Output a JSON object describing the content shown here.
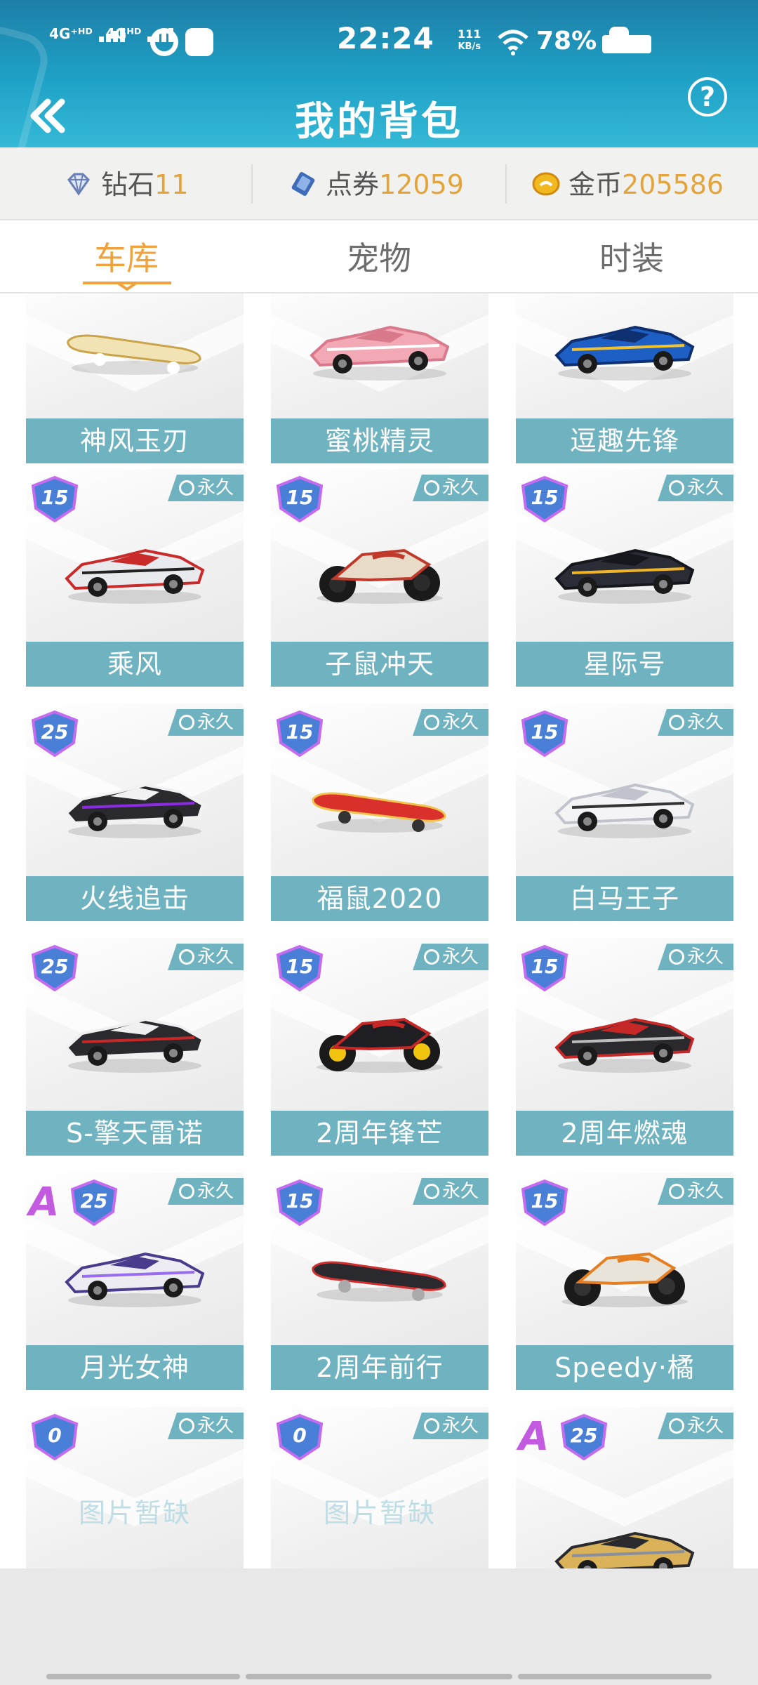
{
  "status_bar": {
    "signal1": "4G⁺ᴴᴰ",
    "signal2": "4Gᴴᴰ",
    "time": "22:24",
    "net_speed_value": "111",
    "net_speed_unit": "KB/s",
    "battery": "78%"
  },
  "header": {
    "title": "我的背包"
  },
  "currencies": [
    {
      "label": "钻石",
      "value": "11"
    },
    {
      "label": "点券",
      "value": "12059"
    },
    {
      "label": "金币",
      "value": "205586"
    }
  ],
  "tabs": [
    {
      "label": "车库",
      "active": true
    },
    {
      "label": "宠物",
      "active": false
    },
    {
      "label": "时装",
      "active": false
    }
  ],
  "perm_label": "永久",
  "cards": [
    {
      "name": "神风玉刃",
      "car": "board-gold"
    },
    {
      "name": "蜜桃精灵",
      "car": "car-pink"
    },
    {
      "name": "逗趣先锋",
      "car": "car-blue"
    },
    {
      "name": "乘风",
      "level": "15",
      "car": "car-red-white"
    },
    {
      "name": "子鼠冲天",
      "level": "15",
      "car": "moto-gold"
    },
    {
      "name": "星际号",
      "level": "15",
      "car": "car-black-gold"
    },
    {
      "name": "火线追击",
      "level": "25",
      "car": "car-black-white"
    },
    {
      "name": "福鼠2020",
      "level": "15",
      "car": "board-red"
    },
    {
      "name": "白马王子",
      "level": "15",
      "car": "car-white"
    },
    {
      "name": "S-擎天雷诺",
      "level": "25",
      "car": "quad-black"
    },
    {
      "name": "2周年锋芒",
      "level": "15",
      "car": "moto-black-red"
    },
    {
      "name": "2周年燃魂",
      "level": "15",
      "car": "car-black-red"
    },
    {
      "name": "月光女神",
      "level": "25",
      "grade": "A",
      "car": "car-purple-white"
    },
    {
      "name": "2周年前行",
      "level": "15",
      "car": "board-black-red"
    },
    {
      "name": "Speedy·橘",
      "level": "15",
      "car": "moto-orange"
    },
    {
      "level": "0",
      "placeholder": "图片暂缺"
    },
    {
      "level": "0",
      "placeholder": "图片暂缺"
    },
    {
      "level": "25",
      "grade": "A",
      "car": "car-gold-black"
    }
  ],
  "colors": {
    "header": "#1fa2c7",
    "label_bar": "#6fb3c1",
    "active_tab": "#f0a23d",
    "currency_value": "#e3a53b"
  }
}
